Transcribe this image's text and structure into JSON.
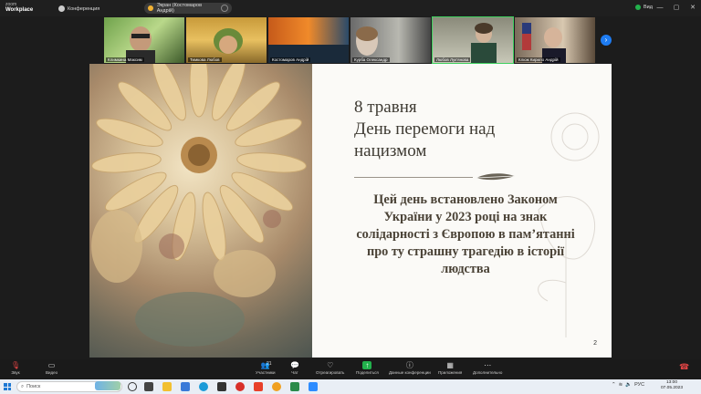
{
  "topbar": {
    "logo_line1": "zoom",
    "logo_line2": "Workplace",
    "conference_label": "Конференция",
    "share_label": "Экран (Костомаров Андрій)",
    "view_label": "Вид",
    "win_min": "—",
    "win_max": "▢",
    "win_close": "✕"
  },
  "gallery": {
    "participants": [
      {
        "name": "Климкина Максим"
      },
      {
        "name": "Тимкова Любов"
      },
      {
        "name": "Костомаров Андрій"
      },
      {
        "name": "Курба Олександр"
      },
      {
        "name": "Любов Лук'янова"
      },
      {
        "name": "Клюж Кирило Андрій"
      }
    ],
    "next_icon": "›"
  },
  "slide": {
    "title_line1": "8 травня",
    "title_line2": "День перемоги над нацизмом",
    "body": "Цей день встановлено Законом України у 2023 році на знак солідарності  з Європою в пам’ятанні про ту страшну трагедію в історії людства",
    "page_number": "2"
  },
  "toolbar": {
    "audio": "Звук",
    "video": "Видео",
    "participants": "Участники",
    "participants_count": "21",
    "chat": "Чат",
    "react": "Отреагировать",
    "share": "Поделиться",
    "conference_data": "Данные конференции",
    "apps": "Приложения",
    "more": "Дополнительно"
  },
  "taskbar": {
    "search_placeholder": "Поиск",
    "lang": "РУС",
    "time": "13:00",
    "date": "07.05.2023"
  },
  "colors": {
    "zoom_green": "#22b14c",
    "accent_blue": "#1e7cf2",
    "end_red": "#e04444"
  }
}
